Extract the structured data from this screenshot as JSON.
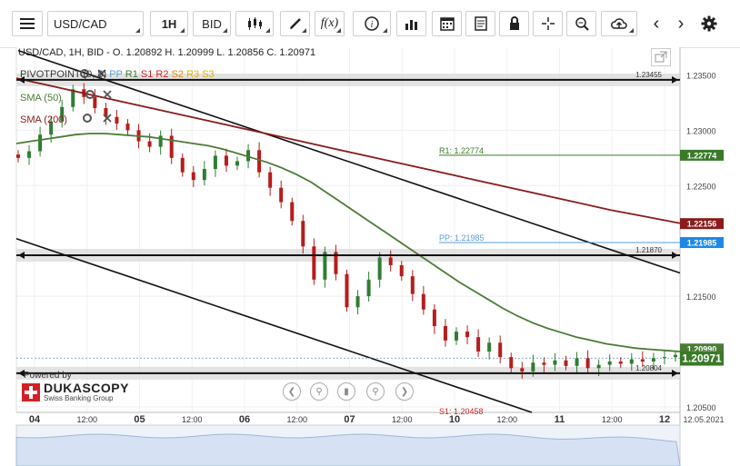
{
  "toolbar": {
    "symbol": "USD/CAD",
    "timeframe": "1H",
    "price_side": "BID",
    "fx_label": "f(x)"
  },
  "header": {
    "ohlc": "USD/CAD, 1H, BID - O. 1.20892 H. 1.20999 L. 1.20856 C. 1.20971"
  },
  "indicators": {
    "pivot": "PIVOTPOINT (0, 8)",
    "pivot_levels": [
      "PP",
      "R1",
      "S1",
      "R2",
      "S2",
      "R3",
      "S3"
    ],
    "sma50": "SMA (50)",
    "sma200": "SMA (200)"
  },
  "branding": {
    "powered": "Powered by",
    "name": "DUKASCOPY",
    "tagline": "Swiss Banking Group"
  },
  "colors": {
    "candle_up": "#2f7d32",
    "candle_down": "#b71c1c",
    "sma50": "#4a7c36",
    "sma200": "#8b1a1a",
    "pp": "#5b9bd5",
    "r1": "#3a7a28",
    "current_price": "#3a7a28",
    "sma200_tag": "#8b1a1a",
    "pp_tag": "#1e88e5"
  },
  "chart_data": {
    "type": "candlestick",
    "y_ticks": [
      "1.23500",
      "1.23000",
      "1.22500",
      "1.21500",
      "1.20500"
    ],
    "x_ticks": [
      "04",
      "12:00",
      "05",
      "12:00",
      "06",
      "12:00",
      "07",
      "12:00",
      "10",
      "12:00",
      "11",
      "12:00",
      "12"
    ],
    "date_label": "12.05.2021",
    "ylim": [
      1.2045,
      1.2375
    ],
    "closes": [
      1.2275,
      1.2281,
      1.2296,
      1.2308,
      1.2321,
      1.2337,
      1.233,
      1.232,
      1.2312,
      1.2306,
      1.23,
      1.229,
      1.2285,
      1.2295,
      1.2275,
      1.2262,
      1.2255,
      1.2265,
      1.2277,
      1.2268,
      1.2272,
      1.2282,
      1.2262,
      1.2248,
      1.2235,
      1.2218,
      1.2195,
      1.2165,
      1.219,
      1.217,
      1.214,
      1.215,
      1.2165,
      1.2185,
      1.2178,
      1.2168,
      1.2152,
      1.2138,
      1.2123,
      1.211,
      1.2118,
      1.2113,
      1.21,
      1.2108,
      1.2095,
      1.2085,
      1.2082,
      1.209,
      1.2088,
      1.2092,
      1.2087,
      1.2094,
      1.2085,
      1.2088,
      1.2091,
      1.2089,
      1.2093,
      1.2091,
      1.2094,
      1.2095,
      1.2097
    ],
    "sma50": [
      1.2288,
      1.229,
      1.2292,
      1.2294,
      1.2296,
      1.2297,
      1.2297,
      1.2296,
      1.2295,
      1.2294,
      1.2292,
      1.229,
      1.2288,
      1.2286,
      1.2283,
      1.2279,
      1.2275,
      1.2271,
      1.2266,
      1.226,
      1.2253,
      1.2244,
      1.2235,
      1.2226,
      1.2217,
      1.2208,
      1.2199,
      1.219,
      1.2181,
      1.2172,
      1.2163,
      1.2155,
      1.2147,
      1.2139,
      1.2132,
      1.2126,
      1.2121,
      1.2117,
      1.2113,
      1.211,
      1.2107,
      1.2105,
      1.2103,
      1.2102,
      1.2101,
      1.21
    ],
    "sma200": [
      1.2347,
      1.234,
      1.2333,
      1.2326,
      1.2319,
      1.2312,
      1.2305,
      1.2298,
      1.2291,
      1.2284,
      1.2277,
      1.227,
      1.2263,
      1.2256,
      1.2249,
      1.2242,
      1.2235,
      1.2228,
      1.2222,
      1.2216
    ],
    "levels": [
      {
        "label": "",
        "value": 1.23455,
        "text": "1.23455"
      },
      {
        "label": "R1",
        "value": 1.22774,
        "text": "1.22774"
      },
      {
        "label": "PP",
        "value": 1.21985,
        "text": "1.21985"
      },
      {
        "label": "",
        "value": 1.2187,
        "text": "1.21870"
      },
      {
        "label": "",
        "value": 1.20804,
        "text": "1.20804"
      },
      {
        "label": "S1",
        "value": 1.20458,
        "text": "1.20458"
      }
    ],
    "price_tags": [
      {
        "name": "r1",
        "value": 1.22774,
        "text": "1.22774"
      },
      {
        "name": "sma200",
        "value": 1.22156,
        "text": "1.22156"
      },
      {
        "name": "pp",
        "value": 1.21985,
        "text": "1.21985"
      },
      {
        "name": "sma50",
        "value": 1.2099,
        "text": "1.20990"
      },
      {
        "name": "close",
        "value": 1.20971,
        "text": "1.20971"
      }
    ]
  }
}
